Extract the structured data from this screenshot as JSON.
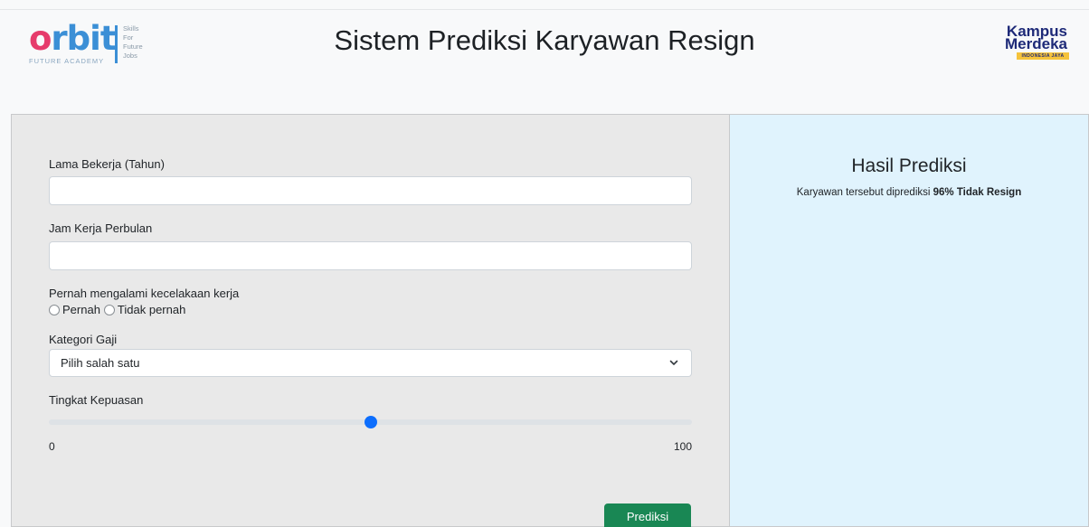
{
  "header": {
    "title": "Sistem Prediksi Karyawan Resign",
    "orbit_logo": {
      "word": "orbit",
      "sub": "FUTURE ACADEMY",
      "tagline": [
        "Skills",
        "For",
        "Future",
        "Jobs"
      ]
    },
    "kampus_logo": {
      "line1": "Kampus",
      "line2": "Merdeka",
      "band": "INDONESIA JAYA"
    }
  },
  "form": {
    "lama_bekerja": {
      "label": "Lama Bekerja (Tahun)",
      "value": ""
    },
    "jam_kerja": {
      "label": "Jam Kerja Perbulan",
      "value": ""
    },
    "kecelakaan": {
      "label": "Pernah mengalami kecelakaan kerja",
      "options": [
        "Pernah",
        "Tidak pernah"
      ]
    },
    "kategori_gaji": {
      "label": "Kategori Gaji",
      "selected": "Pilih salah satu"
    },
    "kepuasan": {
      "label": "Tingkat Kepuasan",
      "min": "0",
      "max": "100",
      "value": 50
    },
    "submit_label": "Prediksi"
  },
  "result": {
    "title": "Hasil Prediksi",
    "text_prefix": "Karyawan tersebut diprediksi",
    "text_bold": "96% Tidak Resign"
  },
  "colors": {
    "primary": "#0d6efd",
    "success": "#198754",
    "result_bg": "#e0f3fd",
    "form_bg": "#e9e9e9"
  }
}
